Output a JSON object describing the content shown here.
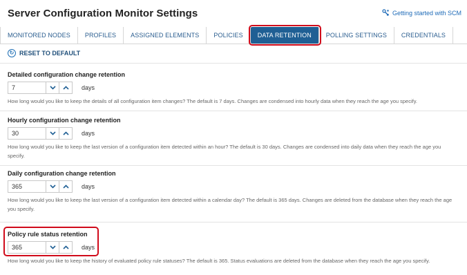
{
  "header": {
    "title": "Server Configuration Monitor Settings",
    "help_link": "Getting started with SCM"
  },
  "tabs": [
    {
      "label": "MONITORED NODES",
      "active": false
    },
    {
      "label": "PROFILES",
      "active": false
    },
    {
      "label": "ASSIGNED ELEMENTS",
      "active": false
    },
    {
      "label": "POLICIES",
      "active": false
    },
    {
      "label": "DATA RETENTION",
      "active": true
    },
    {
      "label": "POLLING SETTINGS",
      "active": false
    },
    {
      "label": "CREDENTIALS",
      "active": false
    }
  ],
  "reset": {
    "label": "RESET TO DEFAULT"
  },
  "sections": [
    {
      "title": "Detailed configuration change retention",
      "value": "7",
      "unit": "days",
      "description": "How long would you like to keep the details of all configuration item changes? The default is 7 days. Changes are condensed into hourly data when they reach the age you specify."
    },
    {
      "title": "Hourly configuration change retention",
      "value": "30",
      "unit": "days",
      "description": "How long would you like to keep the last version of a configuration item detected within an hour? The default is 30 days. Changes are condensed into daily data when they reach the age you specify."
    },
    {
      "title": "Daily configuration change retention",
      "value": "365",
      "unit": "days",
      "description": "How long would you like to keep the last version of a configuration item detected within a calendar day? The default is 365 days. Changes are deleted from the database when they reach the age you specify."
    },
    {
      "title": "Policy rule status retention",
      "value": "365",
      "unit": "days",
      "description": "How long would you like to keep the history of evaluated policy rule statuses? The default is 365. Status evaluations are deleted from the database when they reach the age you specify."
    }
  ],
  "colors": {
    "accent": "#1f5f94",
    "highlight": "#d00a1a",
    "link": "#1e6bb8"
  }
}
